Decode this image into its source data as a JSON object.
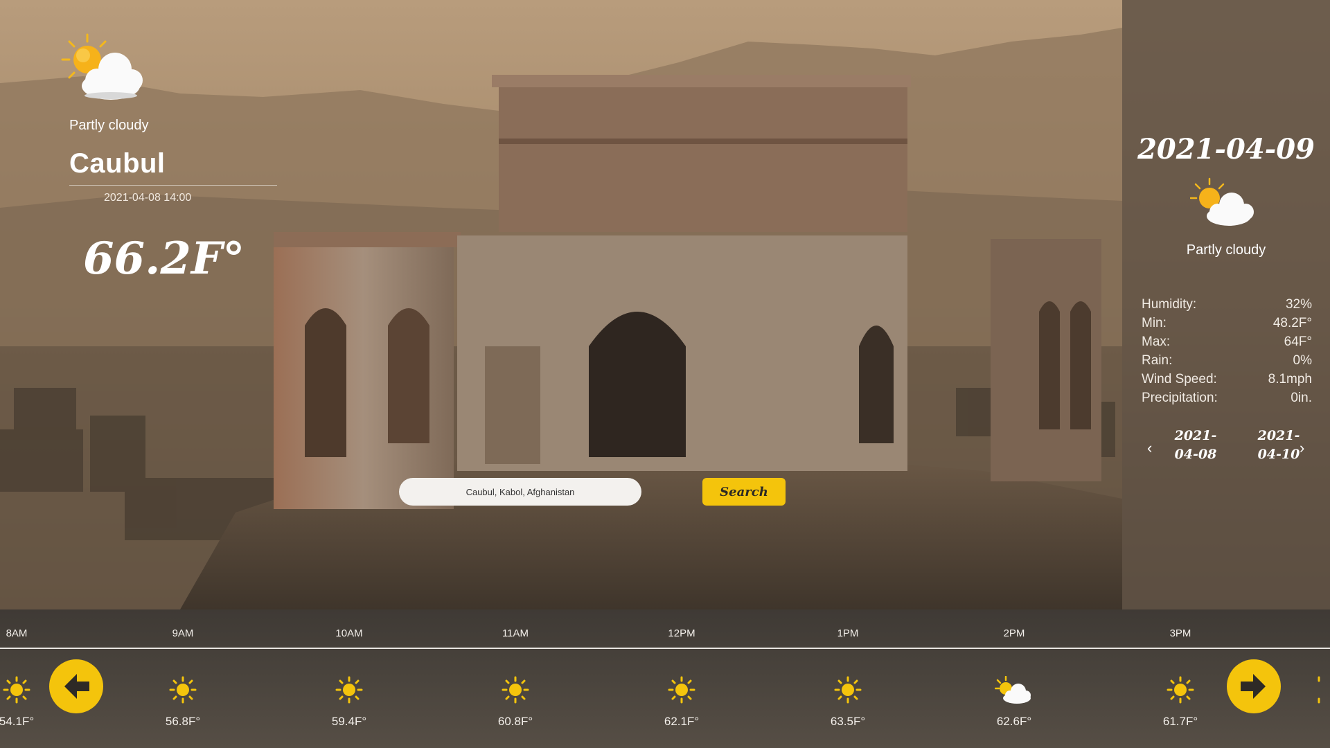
{
  "current": {
    "condition": "Partly cloudy",
    "city": "Caubul",
    "datetime": "2021-04-08 14:00",
    "temperature": "66.2F°",
    "icon": "partly-cloudy-icon"
  },
  "search": {
    "value": "Caubul, Kabol, Afghanistan",
    "button_label": "Search"
  },
  "day_panel": {
    "date": "2021-04-09",
    "icon": "partly-cloudy-icon",
    "condition": "Partly cloudy",
    "stats": [
      {
        "label": "Humidity:",
        "value": "32%"
      },
      {
        "label": "Min:",
        "value": "48.2F°"
      },
      {
        "label": "Max:",
        "value": "64F°"
      },
      {
        "label": "Rain:",
        "value": "0%"
      },
      {
        "label": "Wind Speed:",
        "value": "8.1mph"
      },
      {
        "label": "Precipitation:",
        "value": "0in."
      }
    ],
    "prev_date": {
      "line1": "2021-",
      "line2": "04-08"
    },
    "next_date": {
      "line1": "2021-",
      "line2": "04-10"
    },
    "prev_icon": "chevron-left-icon",
    "next_icon": "chevron-right-icon"
  },
  "hourly": [
    {
      "time": "8AM",
      "temp": "54.1F°",
      "icon": "sun-icon"
    },
    {
      "time": "9AM",
      "temp": "56.8F°",
      "icon": "sun-icon"
    },
    {
      "time": "10AM",
      "temp": "59.4F°",
      "icon": "sun-icon"
    },
    {
      "time": "11AM",
      "temp": "60.8F°",
      "icon": "sun-icon"
    },
    {
      "time": "12PM",
      "temp": "62.1F°",
      "icon": "sun-icon"
    },
    {
      "time": "1PM",
      "temp": "63.5F°",
      "icon": "sun-icon"
    },
    {
      "time": "2PM",
      "temp": "62.6F°",
      "icon": "partly-cloudy-icon"
    },
    {
      "time": "3PM",
      "temp": "61.7F°",
      "icon": "sun-icon"
    }
  ],
  "hourly_nav": {
    "prev_icon": "arrow-left-icon",
    "next_icon": "arrow-right-icon"
  },
  "colors": {
    "accent": "#f4c40c",
    "panel": "#584c40",
    "strip": "#46403a"
  }
}
